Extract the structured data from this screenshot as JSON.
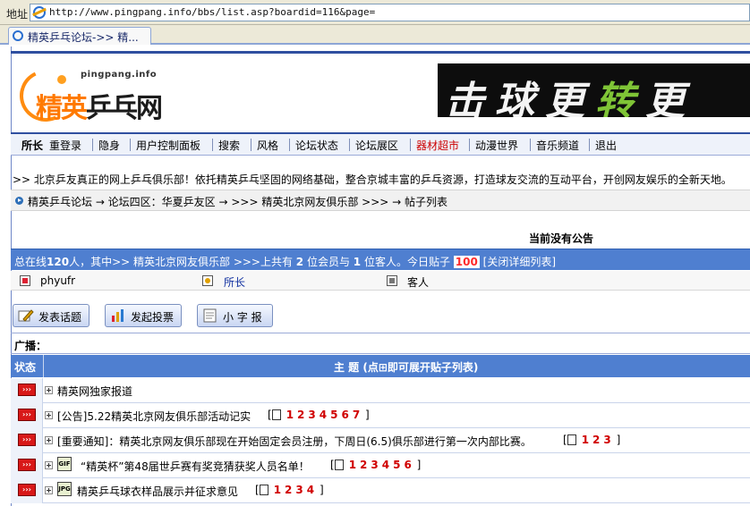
{
  "browser": {
    "address_label": "地址",
    "url": "http://www.pingpang.info/bbs/list.asp?boardid=116&page=",
    "tab_title": "精英乒乓论坛->> 精..."
  },
  "header": {
    "logo_sub": "pingpang.info",
    "logo_main_a": "精英",
    "logo_main_b": "乒乓网",
    "banner_a": "击球更",
    "banner_b": "转",
    "banner_c": "更"
  },
  "nav": {
    "items": [
      {
        "label": "所长",
        "style": "bold"
      },
      {
        "label": "重登录"
      },
      {
        "label": "隐身"
      },
      {
        "label": "用户控制面板"
      },
      {
        "label": "搜索"
      },
      {
        "label": "风格"
      },
      {
        "label": "论坛状态"
      },
      {
        "label": "论坛展区"
      },
      {
        "label": "器材超市",
        "style": "red"
      },
      {
        "label": "动漫世界"
      },
      {
        "label": "音乐频道"
      },
      {
        "label": "退出"
      }
    ]
  },
  "intro": ">> 北京乒友真正的网上乒乓俱乐部！依托精英乒乓坚固的网络基础，整合京城丰富的乒乓资源，打造球友交流的互动平台，开创网友娱乐的全新天地。",
  "breadcrumb": "精英乒乓论坛 → 论坛四区：华夏乒友区 → >>> 精英北京网友俱乐部 >>> → 帖子列表",
  "announcement": "当前没有公告",
  "online": {
    "p1": "总在线",
    "total": "120",
    "p2": "人，其中>> 精英北京网友俱乐部 >>>上共有 ",
    "members": "2",
    "p3": " 位会员与 ",
    "guests": "1",
    "p4": " 位客人。今日贴子 ",
    "today": "100",
    "p5": " [关闭详细列表]"
  },
  "users": [
    {
      "name": "phyufr"
    },
    {
      "name": "所长"
    },
    {
      "name": "客人"
    }
  ],
  "buttons": {
    "post": "发表话题",
    "vote": "发起投票",
    "small": "小 字 报"
  },
  "broadcast_label": "广播：",
  "table": {
    "col_status": "状态",
    "col_topic": "主 题 (点⊞即可展开贴子列表)",
    "status_glyph": "›››",
    "rows": [
      {
        "title": "精英网独家报道",
        "pages": [],
        "ftype": ""
      },
      {
        "title": "[公告]5.22精英北京网友俱乐部活动记实",
        "pages": [
          "1",
          "2",
          "3",
          "4",
          "5",
          "6",
          "7"
        ],
        "ftype": ""
      },
      {
        "title": "[重要通知]：精英北京网友俱乐部现在开始固定会员注册，下周日(6.5)俱乐部进行第一次内部比赛。",
        "pages": [
          "1",
          "2",
          "3"
        ],
        "ftype": ""
      },
      {
        "title": "“精英杯”第48届世乒赛有奖竞猜获奖人员名单！",
        "pages": [
          "1",
          "2",
          "3",
          "4",
          "5",
          "6"
        ],
        "ftype": "GIF"
      },
      {
        "title": "精英乒乓球衣样品展示并征求意见",
        "pages": [
          "1",
          "2",
          "3",
          "4"
        ],
        "ftype": "JPG"
      }
    ]
  }
}
